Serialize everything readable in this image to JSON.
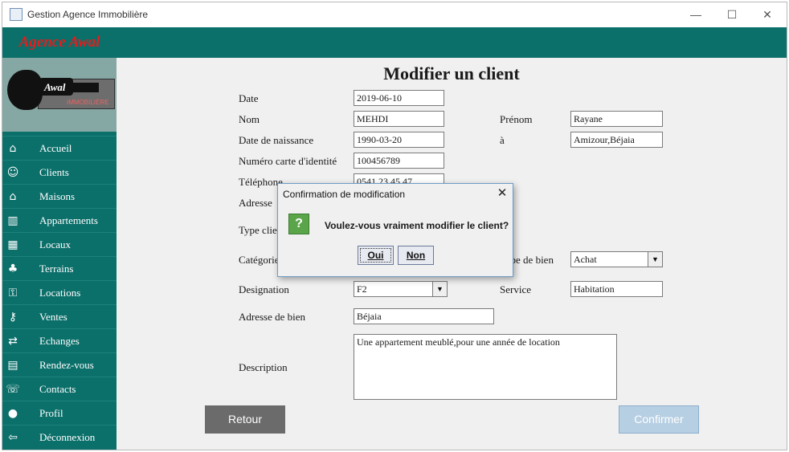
{
  "window": {
    "title": "Gestion Agence Immobilière",
    "controls": {
      "minimize": "—",
      "maximize": "☐",
      "close": "✕"
    }
  },
  "brand": {
    "name": "Agence Awal",
    "logo_name": "Awal",
    "logo_sub": "IMMOBILIÈRE"
  },
  "sidebar": {
    "items": [
      {
        "label": "Accueil",
        "icon": "home-icon"
      },
      {
        "label": "Clients",
        "icon": "clients-icon"
      },
      {
        "label": "Maisons",
        "icon": "house-icon"
      },
      {
        "label": "Appartements",
        "icon": "building-icon"
      },
      {
        "label": "Locaux",
        "icon": "store-icon"
      },
      {
        "label": "Terrains",
        "icon": "land-icon"
      },
      {
        "label": "Locations",
        "icon": "rental-icon"
      },
      {
        "label": "Ventes",
        "icon": "sale-icon"
      },
      {
        "label": "Echanges",
        "icon": "exchange-icon"
      },
      {
        "label": "Rendez-vous",
        "icon": "calendar-icon"
      },
      {
        "label": "Contacts",
        "icon": "contacts-icon"
      },
      {
        "label": "Profil",
        "icon": "profile-icon"
      },
      {
        "label": "Déconnexion",
        "icon": "logout-icon"
      }
    ]
  },
  "form": {
    "title": "Modifier un client",
    "date_label": "Date",
    "date_value": "2019-06-10",
    "nom_label": "Nom",
    "nom_value": "MEHDI",
    "prenom_label": "Prénom",
    "prenom_value": "Rayane",
    "naissance_label": "Date de naissance",
    "naissance_value": "1990-03-20",
    "a_label": "à",
    "a_value": "Amizour,Béjaia",
    "carte_label": "Numéro carte d'identité",
    "carte_value": "100456789",
    "telephone_label": "Téléphone",
    "telephone_value": "0541 23 45 47",
    "adresse_label": "Adresse",
    "type_client_label": "Type client",
    "categorie_label": "Catégorie",
    "type_bien_label": "Type de bien",
    "type_bien_value": "Achat",
    "designation_label": "Designation",
    "designation_value": "F2",
    "service_label": "Service",
    "service_value": "Habitation",
    "adresse_bien_label": "Adresse de bien",
    "adresse_bien_value": "Béjaia",
    "description_label": "Description",
    "description_value": "Une appartement meublé,pour une année de location",
    "retour_label": "Retour",
    "confirmer_label": "Confirmer"
  },
  "dialog": {
    "title": "Confirmation de modification",
    "message": "Voulez-vous vraiment modifier le client?",
    "icon": "question-icon",
    "icon_glyph": "?",
    "yes_label": "Oui",
    "no_label": "Non",
    "close_glyph": "✕"
  },
  "colors": {
    "sidebar": "#0b6f6a",
    "brand_text": "#e21d1d",
    "question_icon": "#5aa54a"
  }
}
